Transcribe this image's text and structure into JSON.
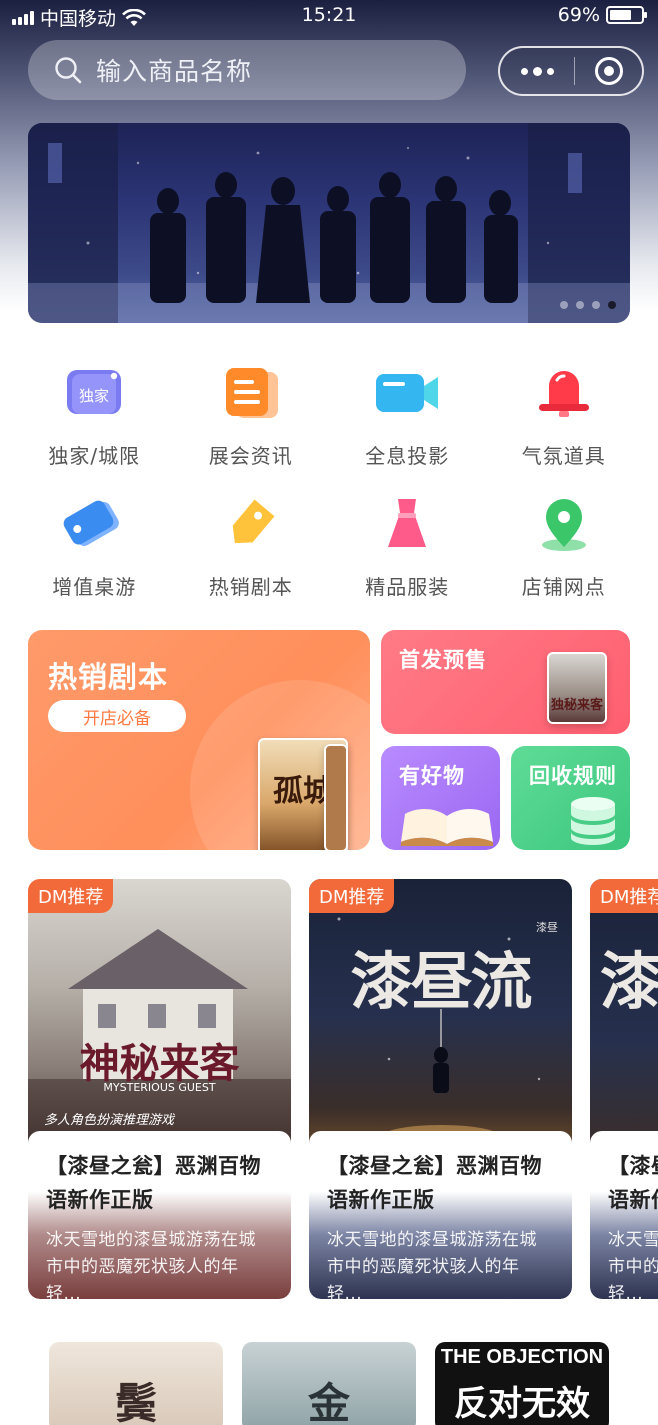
{
  "status_bar": {
    "carrier": "中国移动",
    "time": "15:21",
    "battery": "69%",
    "battery_level": 0.69
  },
  "search": {
    "placeholder": "输入商品名称"
  },
  "banner": {
    "dot_count": 4,
    "active_dot": 4
  },
  "categories": [
    {
      "label": "独家/城限",
      "icon": "exclusive-icon",
      "badge": "独家",
      "color": "#7a7bf0"
    },
    {
      "label": "展会资讯",
      "icon": "news-icon",
      "color": "#ff8a2a"
    },
    {
      "label": "全息投影",
      "icon": "camera-icon",
      "color": "#34b7f0"
    },
    {
      "label": "气氛道具",
      "icon": "bell-icon",
      "color": "#ff3b4a"
    },
    {
      "label": "增值桌游",
      "icon": "ticket-icon",
      "color": "#3b8cf0"
    },
    {
      "label": "热销剧本",
      "icon": "tag-icon",
      "color": "#ffc23a"
    },
    {
      "label": "精品服装",
      "icon": "dress-icon",
      "color": "#ff5b8a"
    },
    {
      "label": "店铺网点",
      "icon": "location-pin-icon",
      "color": "#3cc66a"
    }
  ],
  "promos": {
    "hot": {
      "title": "热销剧本",
      "button": "开店必备",
      "book_text": "孤城"
    },
    "presale": {
      "title": "首发预售",
      "book_text": "独秘来客"
    },
    "goods": {
      "title": "有好物"
    },
    "recycle": {
      "title": "回收规则"
    }
  },
  "products": [
    {
      "tag": "DM推荐",
      "title": "【漆昼之瓮】恶渊百物语新作正版",
      "desc": "冰天雪地的漆昼城游荡在城市中的恶魔死状骇人的年轻...",
      "cover_title": "神秘来客",
      "cover_subtitle": "MYSTERIOUS GUEST",
      "cover_caption": "多人角色扮演推理游戏"
    },
    {
      "tag": "DM推荐",
      "title": "【漆昼之瓮】恶渊百物语新作正版",
      "desc": "冰天雪地的漆昼城游荡在城市中的恶魔死状骇人的年轻...",
      "cover_title": "漆昼流",
      "cover_subtitle": "漆昼"
    },
    {
      "tag": "DM推荐",
      "title": "【漆昼之瓮】恶渊百物语新作正版",
      "desc": "冰天雪地的漆昼城游荡在城市中的恶魔死状骇人的年轻...",
      "cover_title": "漆"
    }
  ],
  "thumbnails": [
    {
      "text": "鬓"
    },
    {
      "text": "金"
    },
    {
      "text": "THE OBJECTION",
      "sub": "反对无效"
    }
  ]
}
